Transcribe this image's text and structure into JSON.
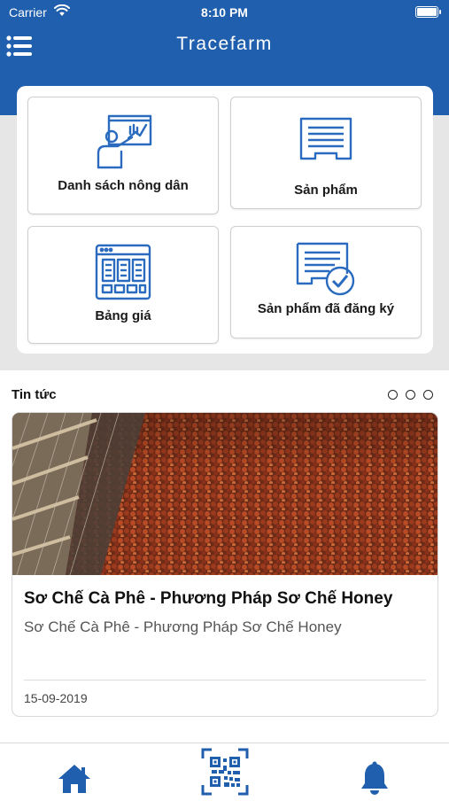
{
  "status_bar": {
    "carrier": "Carrier",
    "time": "8:10 PM"
  },
  "header": {
    "title": "Tracefarm",
    "menu_icon": "list-menu-icon"
  },
  "menu": {
    "tiles": [
      {
        "label": "Danh sách nông dân",
        "icon": "farmer-presentation-icon"
      },
      {
        "label": "Sản phẩm",
        "icon": "document-icon"
      },
      {
        "label": "Bảng giá",
        "icon": "price-table-icon"
      },
      {
        "label": "Sản phẩm đã đăng ký",
        "icon": "certified-document-icon"
      }
    ]
  },
  "news": {
    "section_title": "Tin tức",
    "pager_dots": 3,
    "card": {
      "headline": "Sơ Chế Cà Phê - Phương Pháp Sơ Chế Honey",
      "subtitle": "Sơ Chế Cà Phê - Phương Pháp Sơ Chế Honey",
      "date": "15-09-2019"
    }
  },
  "tabbar": {
    "items": [
      "home-icon",
      "qr-code-icon",
      "bell-icon"
    ]
  },
  "colors": {
    "primary": "#1f5fad",
    "background_band": "#e6e6e6",
    "accent_icon": "#2a6bbf"
  }
}
